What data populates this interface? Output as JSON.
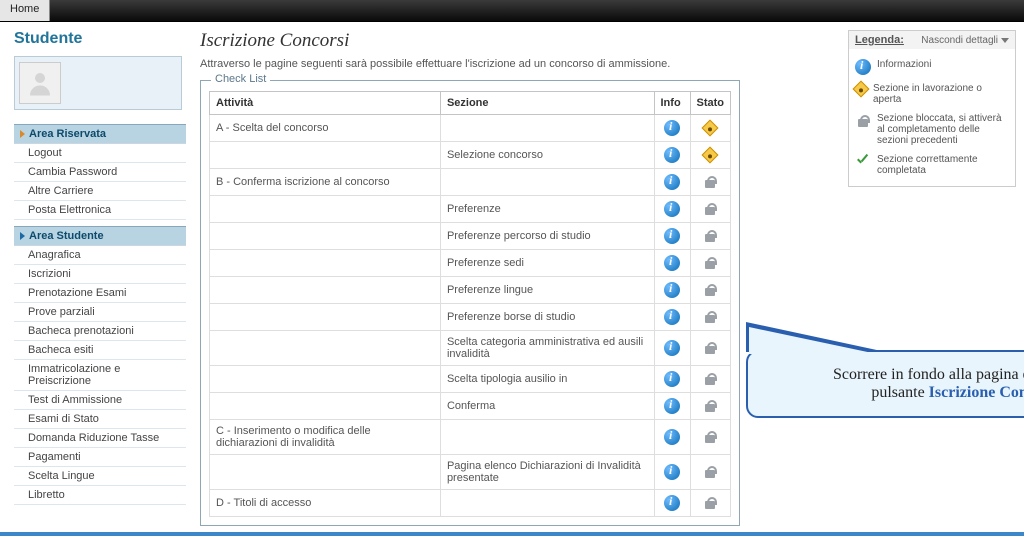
{
  "topbar": {
    "home": "Home"
  },
  "sidebar": {
    "title": "Studente",
    "group1": {
      "head": "Area Riservata",
      "items": [
        "Logout",
        "Cambia Password",
        "Altre Carriere",
        "Posta Elettronica"
      ]
    },
    "group2": {
      "head": "Area Studente",
      "items": [
        "Anagrafica",
        "Iscrizioni",
        "Prenotazione Esami",
        "Prove parziali",
        "Bacheca prenotazioni",
        "Bacheca esiti",
        "Immatricolazione e Preiscrizione",
        "Test di Ammissione",
        "Esami di Stato",
        "Domanda Riduzione Tasse",
        "Pagamenti",
        "Scelta Lingue",
        "Libretto"
      ]
    }
  },
  "main": {
    "title": "Iscrizione Concorsi",
    "intro": "Attraverso le pagine seguenti sarà possibile effettuare l'iscrizione ad un concorso di ammissione.",
    "legend": "Check List",
    "cols": {
      "attivita": "Attività",
      "sezione": "Sezione",
      "info": "Info",
      "stato": "Stato"
    },
    "rows": [
      {
        "a": "A - Scelta del concorso",
        "s": "",
        "st": "warn"
      },
      {
        "a": "",
        "s": "Selezione concorso",
        "st": "warn"
      },
      {
        "a": "B - Conferma iscrizione al concorso",
        "s": "",
        "st": "lock"
      },
      {
        "a": "",
        "s": "Preferenze",
        "st": "lock"
      },
      {
        "a": "",
        "s": "Preferenze percorso di studio",
        "st": "lock"
      },
      {
        "a": "",
        "s": "Preferenze sedi",
        "st": "lock"
      },
      {
        "a": "",
        "s": "Preferenze lingue",
        "st": "lock"
      },
      {
        "a": "",
        "s": "Preferenze borse di studio",
        "st": "lock"
      },
      {
        "a": "",
        "s": "Scelta categoria amministrativa ed ausili invalidità",
        "st": "lock"
      },
      {
        "a": "",
        "s": "Scelta tipologia ausilio in",
        "st": "lock"
      },
      {
        "a": "",
        "s": "Conferma",
        "st": "lock"
      },
      {
        "a": "C - Inserimento o modifica delle dichiarazioni di invalidità",
        "s": "",
        "st": "lock"
      },
      {
        "a": "",
        "s": "Pagina elenco Dichiarazioni di Invalidità presentate",
        "st": "lock"
      },
      {
        "a": "D - Titoli di accesso",
        "s": "",
        "st": "lock"
      }
    ]
  },
  "legendbox": {
    "title": "Legenda:",
    "collapse": "Nascondi dettagli",
    "items": [
      {
        "icon": "info",
        "text": "Informazioni"
      },
      {
        "icon": "warn",
        "text": "Sezione in lavorazione o aperta"
      },
      {
        "icon": "lock",
        "text": "Sezione bloccata, si attiverà al completamento delle sezioni precedenti"
      },
      {
        "icon": "check",
        "text": "Sezione correttamente completata"
      }
    ]
  },
  "callout": {
    "line1": "Scorrere in fondo alla pagina e premere il",
    "line2a": "pulsante ",
    "line2b": "Iscrizione Concorsi"
  }
}
